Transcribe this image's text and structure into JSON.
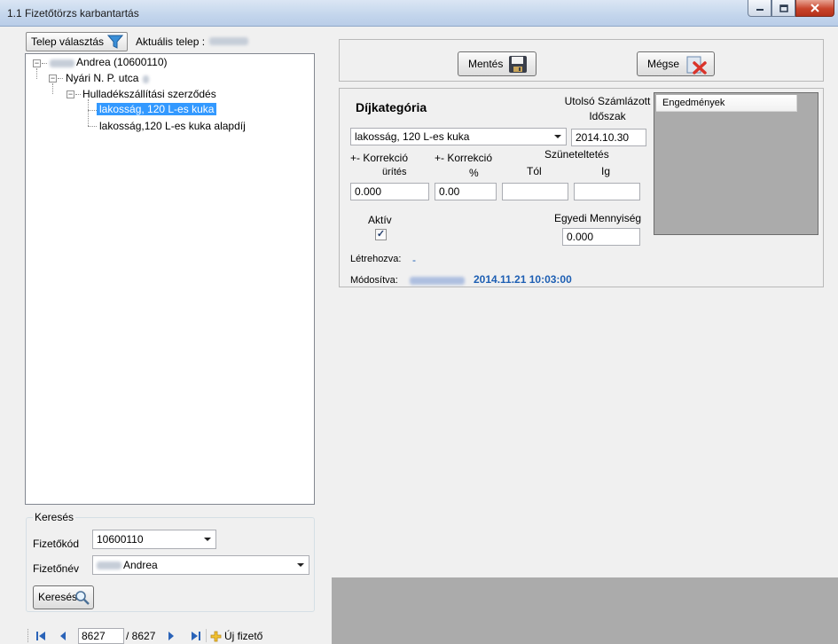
{
  "window": {
    "title": "1.1 Fizetőtörzs karbantartás",
    "min_icon": "minimize-icon",
    "max_icon": "maximize-icon",
    "close_icon": "close-icon"
  },
  "left": {
    "telep_button_label": "Telep választás",
    "aktualis_label": "Aktuális telep :",
    "tree": {
      "root": "Andrea (10600110)",
      "street": "Nyári N. P. utca",
      "contract": "Hulladékszállítási szerződés",
      "item_selected": "lakosság, 120 L-es kuka",
      "item_2": "lakosság,120 L-es kuka alapdíj"
    },
    "search": {
      "legend": "Keresés",
      "fizetokod_label": "Fizetőkód",
      "fizetokod_value": "10600110",
      "fizetonev_label": "Fizetőnév",
      "fizetonev_value": "Andrea",
      "button_label": "Keresés"
    },
    "nav": {
      "current": "8627",
      "total": "/ 8627",
      "new_label": "Új fizető"
    }
  },
  "right": {
    "save_label": "Mentés",
    "cancel_label": "Mégse",
    "dijkategoria_label": "Díjkategória",
    "dijkategoria_value": "lakosság, 120 L-es kuka",
    "utolso_label_1": "Utolsó Számlázott",
    "utolso_label_2": "Időszak",
    "utolso_value": "2014.10.30",
    "korr_urites_1": "+- Korrekció",
    "korr_urites_2": "ürítés",
    "korr_urites_value": "0.000",
    "korr_pct_1": "+- Korrekció",
    "korr_pct_2": "%",
    "korr_pct_value": "0.00",
    "szunet_label": "Szüneteltetés",
    "tol_label": "Tól",
    "ig_label": "Ig",
    "tol_value": "",
    "ig_value": "",
    "aktiv_label": "Aktív",
    "aktiv_checked": true,
    "egyedi_label": "Egyedi Mennyiség",
    "egyedi_value": "0.000",
    "letrehozva_label": "Létrehozva:",
    "letrehozva_value": "-",
    "modositva_label": "Módosítva:",
    "modositva_value": "2014.11.21 10:03:00",
    "engedmenyek_header": "Engedmények"
  },
  "colors": {
    "selection": "#3399ff",
    "link_blue": "#1e5fb3",
    "gray_panel": "#ababab"
  }
}
